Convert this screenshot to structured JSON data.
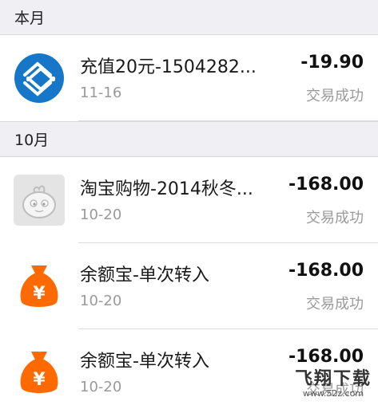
{
  "sections": [
    {
      "header": "本月",
      "items": [
        {
          "icon": "china-mobile-logo-icon",
          "title": "充值20元-1504282...",
          "amount": "-19.90",
          "date": "11-16",
          "status": "交易成功"
        }
      ]
    },
    {
      "header": "10月",
      "items": [
        {
          "icon": "taobao-avatar-icon",
          "title": "淘宝购物-2014秋冬...",
          "amount": "-168.00",
          "date": "10-20",
          "status": "交易成功"
        },
        {
          "icon": "money-bag-yen-icon",
          "title": "余额宝-单次转入",
          "amount": "-168.00",
          "date": "10-20",
          "status": "交易成功"
        },
        {
          "icon": "money-bag-yen-icon",
          "title": "余额宝-单次转入",
          "amount": "-168.00",
          "date": "10-20",
          "status": "交易成功"
        }
      ]
    }
  ],
  "colors": {
    "section_bg": "#efeff4",
    "china_mobile_blue": "#1677c8",
    "money_bag_orange": "#ff6a00",
    "status_gray": "#9a9a9a"
  },
  "watermark": {
    "main": "飞翔下载",
    "sub": "www.52z.com"
  }
}
